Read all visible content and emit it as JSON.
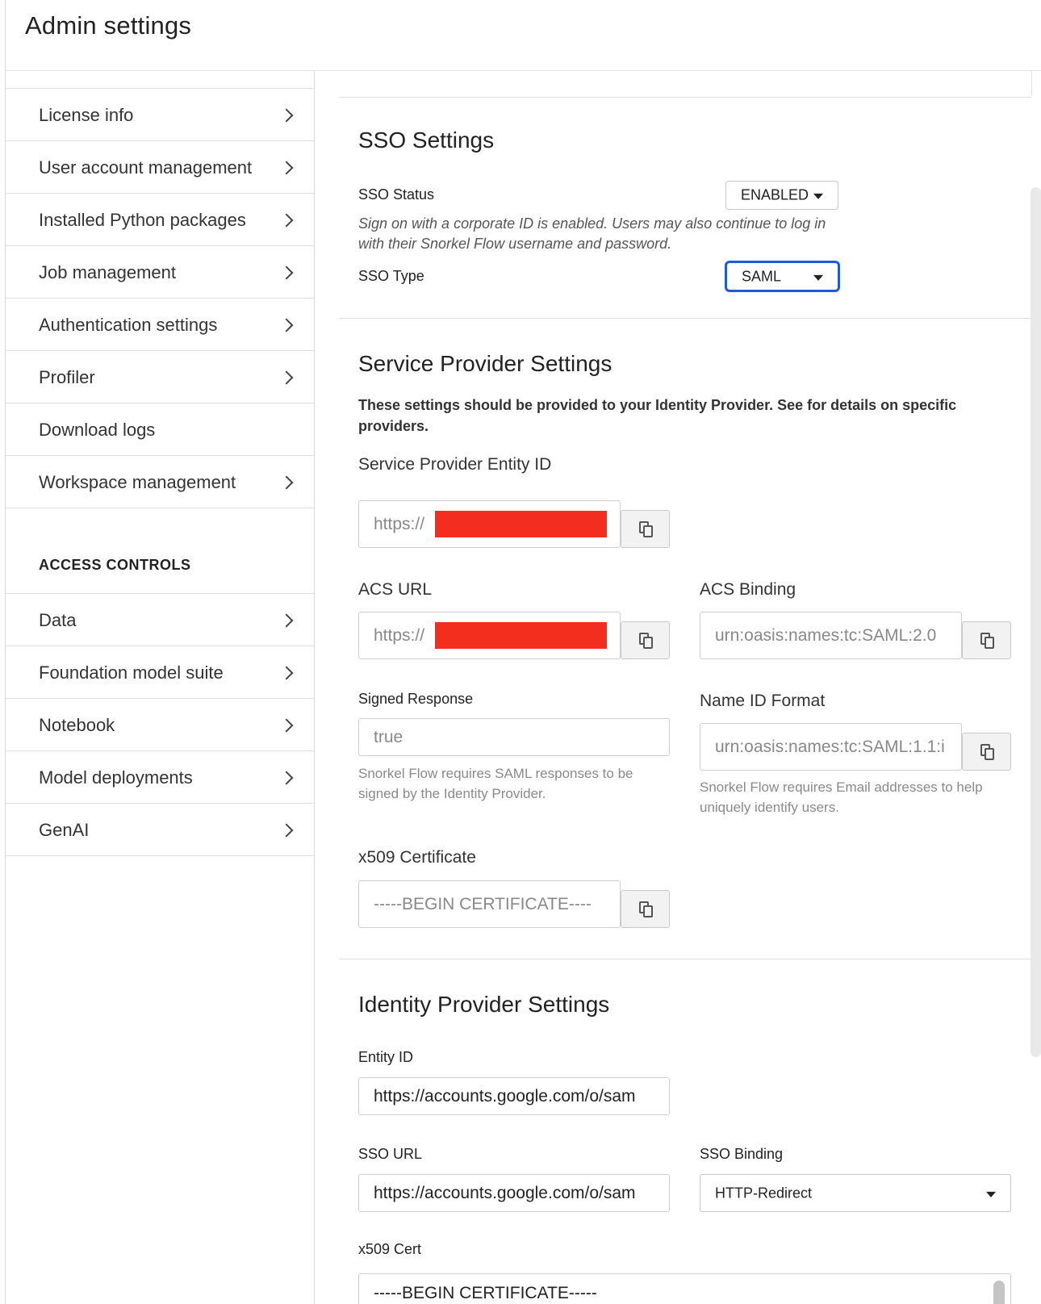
{
  "page": {
    "title": "Admin settings"
  },
  "sidebar": {
    "items": [
      {
        "label": "License info",
        "chevron": true
      },
      {
        "label": "User account management",
        "chevron": true
      },
      {
        "label": "Installed Python packages",
        "chevron": true
      },
      {
        "label": "Job management",
        "chevron": true
      },
      {
        "label": "Authentication settings",
        "chevron": true
      },
      {
        "label": "Profiler",
        "chevron": true
      },
      {
        "label": "Download logs",
        "chevron": false
      },
      {
        "label": "Workspace management",
        "chevron": true
      }
    ],
    "access_heading": "ACCESS CONTROLS",
    "access_items": [
      {
        "label": "Data",
        "chevron": true
      },
      {
        "label": "Foundation model suite",
        "chevron": true
      },
      {
        "label": "Notebook",
        "chevron": true
      },
      {
        "label": "Model deployments",
        "chevron": true
      },
      {
        "label": "GenAI",
        "chevron": true
      }
    ]
  },
  "sso": {
    "title": "SSO Settings",
    "status_label": "SSO Status",
    "status_value": "ENABLED",
    "status_help": "Sign on with a corporate ID is enabled. Users may also continue to log in with their Snorkel Flow username and password.",
    "type_label": "SSO Type",
    "type_value": "SAML"
  },
  "service_provider": {
    "title": "Service Provider Settings",
    "note": "These settings should be provided to your Identity Provider. See for details on specific providers.",
    "entity_id_label": "Service Provider Entity ID",
    "entity_id_value": "https://",
    "acs_url_label": "ACS URL",
    "acs_url_value": "https://",
    "acs_binding_label": "ACS Binding",
    "acs_binding_value": "urn:oasis:names:tc:SAML:2.0",
    "signed_response_label": "Signed Response",
    "signed_response_value": "true",
    "signed_response_help": "Snorkel Flow requires SAML responses to be signed by the Identity Provider.",
    "name_id_label": "Name ID Format",
    "name_id_value": "urn:oasis:names:tc:SAML:1.1:i",
    "name_id_help": "Snorkel Flow requires Email addresses to help uniquely identify users.",
    "x509_label": "x509 Certificate",
    "x509_value": "-----BEGIN CERTIFICATE----",
    "redaction_color": "#f42e1f"
  },
  "identity_provider": {
    "title": "Identity Provider Settings",
    "entity_id_label": "Entity ID",
    "entity_id_value": "https://accounts.google.com/o/sam",
    "sso_url_label": "SSO URL",
    "sso_url_value": "https://accounts.google.com/o/sam",
    "sso_binding_label": "SSO Binding",
    "sso_binding_value": "HTTP-Redirect",
    "x509_cert_label": "x509 Cert",
    "x509_cert_value": "-----BEGIN CERTIFICATE-----"
  },
  "colors": {
    "focus_ring": "#1e5bd6"
  },
  "icons": [
    "chevron-right-icon",
    "copy-icon",
    "caret-down-icon"
  ]
}
